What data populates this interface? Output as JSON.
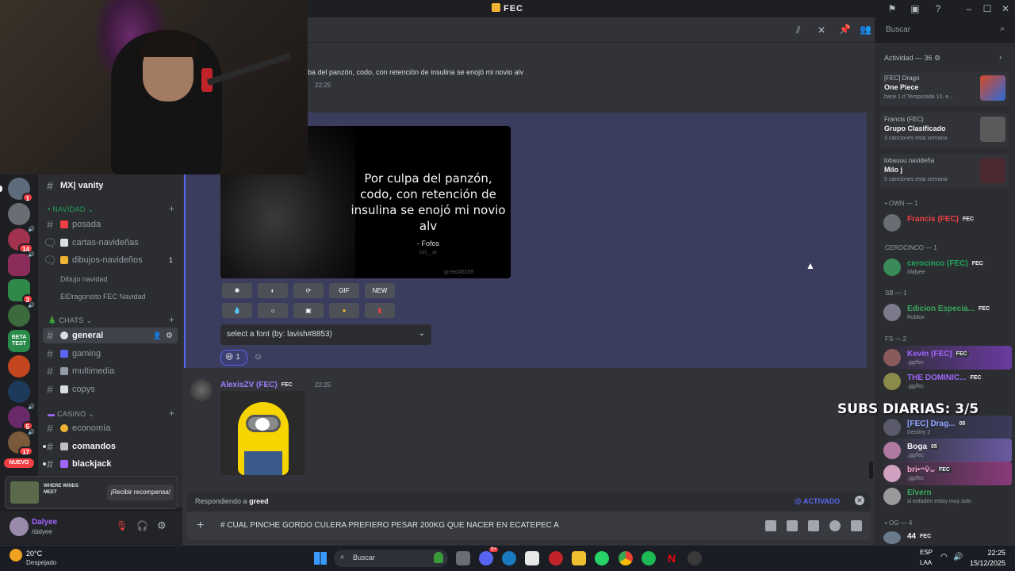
{
  "app": {
    "title": "FEC"
  },
  "header": {
    "search_placeholder": "Buscar"
  },
  "server_rail": {
    "badges": [
      "1",
      "14",
      "3",
      "5",
      "17"
    ],
    "nuevo": "NUEVO",
    "beta_label": "BETA TEST"
  },
  "channels": {
    "vanity": "MX| vanity",
    "cat_navidad": "• NAVIDAD ⌄",
    "posada": "posada",
    "cartas": "cartas-navideñas",
    "dibujos": "dibujos-navideños",
    "dibujos_count": "1",
    "dibujo_navidad": "Dibujo navidad",
    "eldragonsito": "ElDragonsito FEC Navidad",
    "cat_chats": "CHATS ⌄",
    "general": "general",
    "gaming": "gaming",
    "multimedia": "multimedia",
    "copys": "copys",
    "cat_casino": "CASINO ⌄",
    "economia": "economía",
    "comandos": "comandos",
    "blackjack": "blackjack"
  },
  "rewards": {
    "game": "WHERE WINDS MEET",
    "button": "¡Recibir recompensa!"
  },
  "user": {
    "name": "Dalyee",
    "status": "/dalyee"
  },
  "messages": {
    "reply_snippet": "ba del panzón, codo, con retención de insulina se enojó mi novio alv",
    "reply_time": "22:25",
    "quote_text": "Por culpa del panzón, codo, con retención de insulina se enojó mi novio alv",
    "quote_author": "- Fofos",
    "quote_handle": "fofil__ok",
    "quote_id": "greed#6058",
    "buttons_row1": [
      "✱",
      "◐",
      "⟳",
      "GIF",
      "NEW"
    ],
    "buttons_row2": [
      "💧",
      "☼",
      "▣",
      "●",
      "▮"
    ],
    "font_select": "select a font (by: lavish#8853)",
    "reaction_count": "1",
    "msg2_author": "AlexisZV (FEC)",
    "msg2_tag": "FEC",
    "msg2_time": "22:25"
  },
  "composer": {
    "replying_prefix": "Respondiendo a ",
    "replying_to": "greed",
    "activado": "@ ACTIVADO",
    "text": "# CUAL PINCHE GORDO CULERA PREFIERO PESAR 200KG QUE NACER EN ECATEPEC A"
  },
  "members": {
    "activity_header": "Actividad — 36",
    "activity": [
      {
        "user": "[FEC] Drago",
        "title": "One Piece",
        "meta": "hace 1 d   Temporada 10, e..."
      },
      {
        "user": "Francis (FEC)",
        "title": "Grupo Clasificado",
        "meta": "3 canciones esta semana"
      },
      {
        "user": "lobauuu navideña",
        "title": "Milo j",
        "meta": "5 canciones esta semana"
      }
    ],
    "own_header": "• OWN — 1",
    "own": [
      {
        "name": "Francis (FEC)",
        "tag": "FEC",
        "color": "#f23f43"
      }
    ],
    "cero_header": "CEROCINCO — 1",
    "cero": [
      {
        "name": "cerocinco (FEC)",
        "tag": "FEC",
        "status": "/dalyee",
        "color": "#23a55a"
      }
    ],
    "sb_header": "SB — 1",
    "sb": [
      {
        "name": "Edicion Especia...",
        "tag": "FEC",
        "status": "Roblox",
        "color": "#3ba55c"
      }
    ],
    "fs_header": "FS — 2",
    "fs": [
      {
        "name": "Kevin (FEC)",
        "tag": "FEC",
        "status": ".gg/fec",
        "color": "#a066ff"
      },
      {
        "name": "THE DOMINIC...",
        "tag": "FEC",
        "status": ".gg/fec",
        "color": "#a066ff"
      }
    ],
    "subs_label": "SUBS DIARIAS: 3/5",
    "subs": [
      {
        "name": "[FEC] Drag...",
        "tag": "05",
        "status": "Destiny 2",
        "color": "#8fa4ff"
      },
      {
        "name": "Boga",
        "tag": "05",
        "status": ".gg/fec",
        "color": "#f2f3f5"
      },
      {
        "name": "bri•ᴖѷᴗ",
        "tag": "FEC",
        "status": ".gg/fec",
        "color": "#f2a4d0"
      },
      {
        "name": "Elvern",
        "tag": "",
        "status": "si enfaden estoy muy solo",
        "color": "#3ba55c"
      }
    ],
    "og_header": "• OG — 4",
    "og": [
      {
        "name": "44",
        "tag": "FEC",
        "status": "",
        "color": "#f2f3f5"
      }
    ]
  },
  "taskbar": {
    "temp": "20°C",
    "weather": "Despejado",
    "search": "Buscar",
    "lang1": "ESP",
    "lang2": "LAA",
    "time": "22:25",
    "date": "15/12/2025",
    "discord_badge": "9+"
  },
  "colors": {
    "accent": "#5865f2",
    "highlight": "#3b3d5e",
    "danger": "#f23f43"
  }
}
